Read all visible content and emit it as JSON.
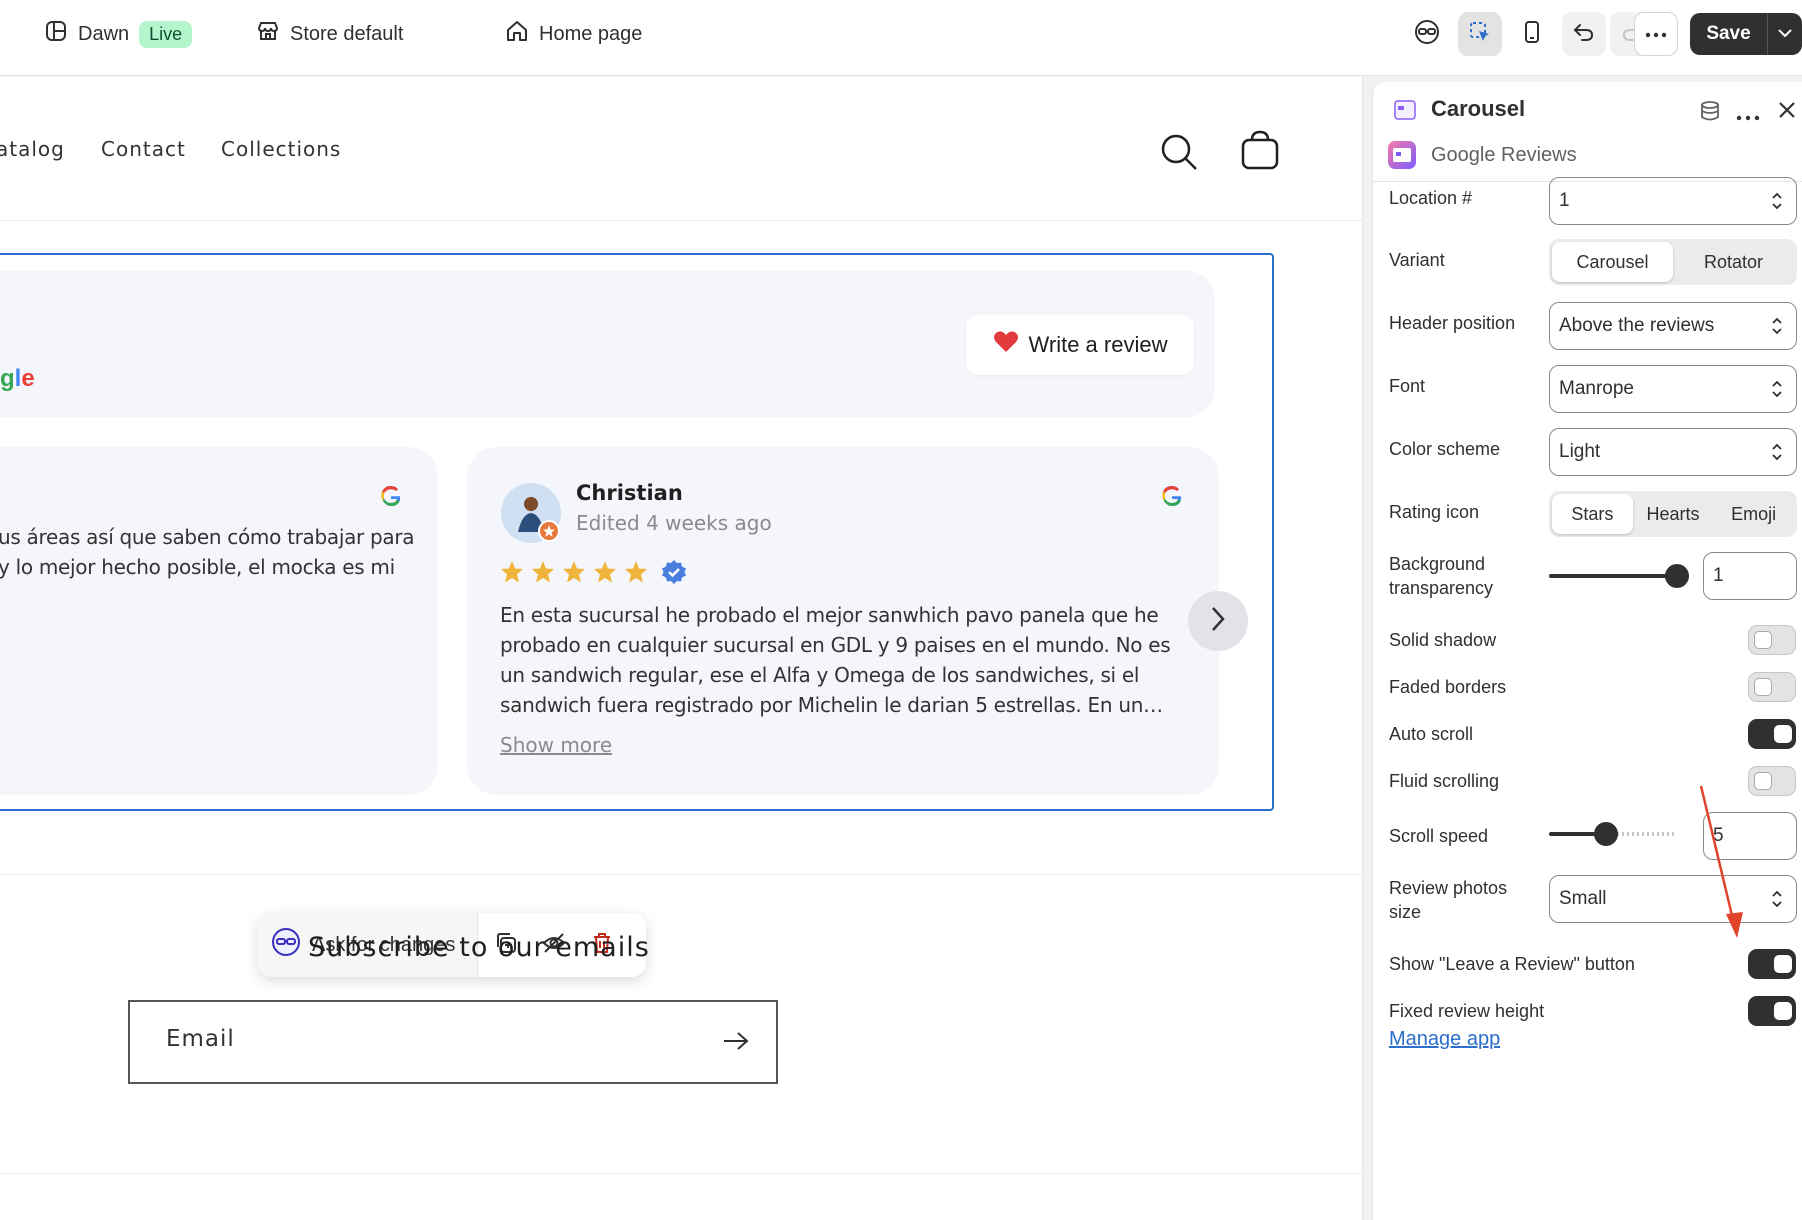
{
  "topbar": {
    "theme_name": "Dawn",
    "live_badge": "Live",
    "store_label": "Store default",
    "page_label": "Home page",
    "save_label": "Save"
  },
  "storefront": {
    "nav": [
      "atalog",
      "Contact",
      "Collections"
    ],
    "write_review": "Write a review",
    "google_word_partial": "gle",
    "left_review_lines": [
      "us áreas así que saben cómo trabajar para",
      "y lo mejor hecho posible, el mocka es mi"
    ],
    "reviewer_name": "Christian",
    "reviewer_date": "Edited 4 weeks ago",
    "rating": 5,
    "review_lines": [
      "En esta sucursal he probado el mejor sanwhich pavo panela que he",
      "probado en cualquier sucursal en GDL y 9 paises en el mundo. No es",
      "un sandwich regular, ese el Alfa y Omega de los sandwiches, si el",
      "sandwich fuera registrado por Michelin le darian 5 estrellas. En un…"
    ],
    "show_more": "Show more",
    "ask_changes": "Ask for changes",
    "subscribe_title": "Subscribe to our emails",
    "email_placeholder": "Email"
  },
  "panel": {
    "title": "Carousel",
    "subtitle": "Google Reviews",
    "location_label": "Location #",
    "location_value": "1",
    "variant_label": "Variant",
    "variant_options": [
      "Carousel",
      "Rotator"
    ],
    "header_position_label": "Header position",
    "header_position_value": "Above the reviews",
    "font_label": "Font",
    "font_value": "Manrope",
    "color_scheme_label": "Color scheme",
    "color_scheme_value": "Light",
    "rating_icon_label": "Rating icon",
    "rating_icon_options": [
      "Stars",
      "Hearts",
      "Emoji"
    ],
    "bg_transparency_label_1": "Background",
    "bg_transparency_label_2": "transparency",
    "bg_transparency_value": "1",
    "solid_shadow_label": "Solid shadow",
    "faded_borders_label": "Faded borders",
    "auto_scroll_label": "Auto scroll",
    "fluid_scrolling_label": "Fluid scrolling",
    "scroll_speed_label": "Scroll speed",
    "scroll_speed_value": "5",
    "review_photos_label_1": "Review photos",
    "review_photos_label_2": "size",
    "review_photos_value": "Small",
    "leave_review_label": "Show \"Leave a Review\" button",
    "fixed_height_label": "Fixed review height",
    "manage_app": "Manage app",
    "toggles": {
      "solid_shadow": false,
      "faded_borders": false,
      "auto_scroll": true,
      "fluid_scrolling": false,
      "leave_review": true,
      "fixed_height": true
    }
  },
  "colors": {
    "accent_blue": "#2c6ecb",
    "star": "#f0b43c",
    "annotation_arrow": "#e0452b"
  }
}
